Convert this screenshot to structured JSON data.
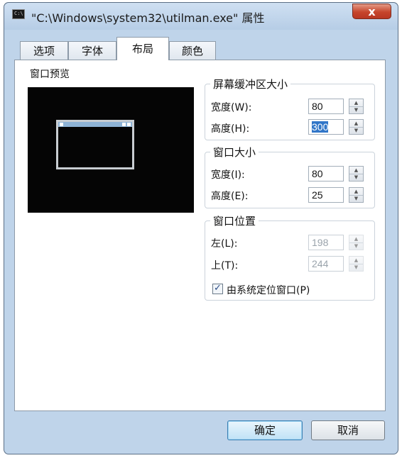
{
  "window": {
    "title": "\"C:\\Windows\\system32\\utilman.exe\" 属性",
    "icon_text": "C:\\",
    "close_label": "x"
  },
  "tabs": [
    {
      "label": "选项"
    },
    {
      "label": "字体"
    },
    {
      "label": "布局",
      "active": true
    },
    {
      "label": "颜色"
    }
  ],
  "preview": {
    "label": "窗口预览"
  },
  "buffer_size": {
    "title": "屏幕缓冲区大小",
    "width_label": "宽度(W):",
    "width_value": "80",
    "height_label": "高度(H):",
    "height_value": "300"
  },
  "window_size": {
    "title": "窗口大小",
    "width_label": "宽度(I):",
    "width_value": "80",
    "height_label": "高度(E):",
    "height_value": "25"
  },
  "window_position": {
    "title": "窗口位置",
    "left_label": "左(L):",
    "left_value": "198",
    "top_label": "上(T):",
    "top_value": "244",
    "checkbox_label": "由系统定位窗口(P)",
    "checkbox_checked": true
  },
  "buttons": {
    "ok": "确定",
    "cancel": "取消"
  },
  "icons": {
    "spin_up": "▲",
    "spin_down": "▼",
    "check": "✓"
  },
  "colors": {
    "window_frame": "#bfd4ea",
    "close_button": "#c6452c",
    "selection": "#3176c8",
    "preview_bg": "#050505"
  }
}
